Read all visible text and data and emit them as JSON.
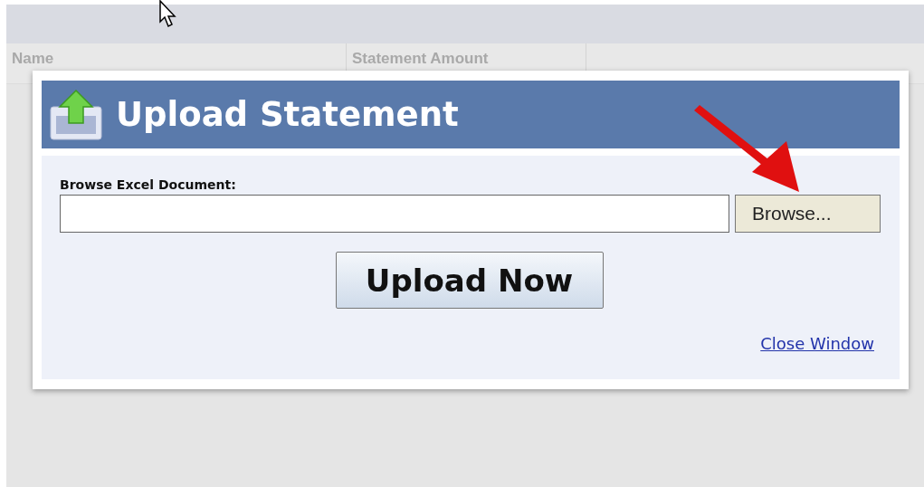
{
  "table": {
    "columns": [
      {
        "label": "Name"
      },
      {
        "label": "Statement Amount"
      }
    ]
  },
  "dialog": {
    "title": "Upload Statement",
    "field_label": "Browse Excel Document:",
    "browse_button": "Browse...",
    "submit_button": "Upload Now",
    "close_link": "Close Window"
  }
}
